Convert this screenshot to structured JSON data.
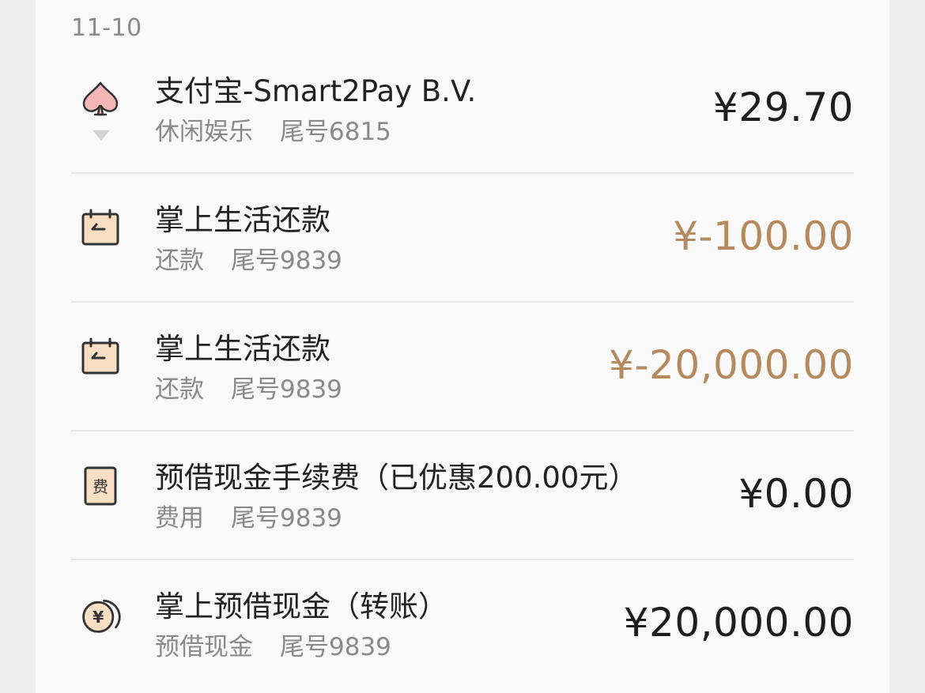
{
  "date": "11-10",
  "colors": {
    "refund": "#b48a5e",
    "normal": "#1e1e1e",
    "icon_fill": "#f8dfc4",
    "icon_stroke": "#333333",
    "spade": "#f4b7b3"
  },
  "transactions": [
    {
      "icon": "spade-icon",
      "title": "支付宝-Smart2Pay B.V.",
      "category": "休闲娱乐",
      "card": "尾号6815",
      "amount": "¥29.70",
      "type": "expense"
    },
    {
      "icon": "calendar-repay-icon",
      "title": "掌上生活还款",
      "category": "还款",
      "card": "尾号9839",
      "amount": "¥-100.00",
      "type": "repayment"
    },
    {
      "icon": "calendar-repay-icon",
      "title": "掌上生活还款",
      "category": "还款",
      "card": "尾号9839",
      "amount": "¥-20,000.00",
      "type": "repayment"
    },
    {
      "icon": "fee-icon",
      "fee_glyph": "费",
      "title": "预借现金手续费（已优惠200.00元）",
      "category": "费用",
      "card": "尾号9839",
      "amount": "¥0.00",
      "type": "fee"
    },
    {
      "icon": "yen-coin-icon",
      "coin_glyph": "¥",
      "title": "掌上预借现金（转账）",
      "category": "预借现金",
      "card": "尾号9839",
      "amount": "¥20,000.00",
      "type": "cash-advance"
    }
  ]
}
